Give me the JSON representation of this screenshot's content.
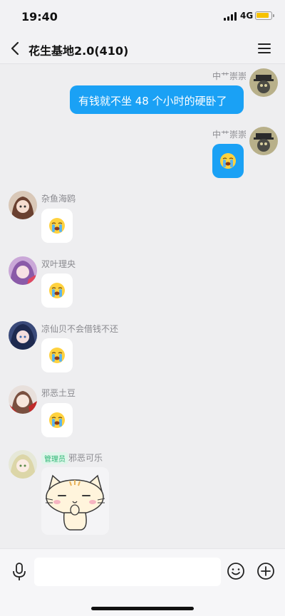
{
  "status_bar": {
    "time": "19:40",
    "network": "4G",
    "battery_level": 0.8,
    "battery_color": "#f6c200"
  },
  "nav": {
    "title": "花生基地2.0(410)",
    "back_icon": "chevron-left-icon",
    "menu_icon": "hamburger-menu-icon"
  },
  "colors": {
    "accent_blue": "#1aa1f5",
    "admin_green": "#2bb673",
    "background": "#eeeef0"
  },
  "messages": [
    {
      "sender": "中艹崇崇",
      "side": "right",
      "type": "text",
      "text": "有钱就不坐 48 个小时的硬卧了"
    },
    {
      "sender": "中艹崇崇",
      "side": "right",
      "type": "emoji",
      "emoji": "loudly-crying-face"
    },
    {
      "sender": "杂鱼海鸥",
      "side": "left",
      "type": "emoji",
      "emoji": "loudly-crying-face"
    },
    {
      "sender": "双叶理央",
      "side": "left",
      "type": "emoji",
      "emoji": "loudly-crying-face"
    },
    {
      "sender": "凉仙贝不会借钱不还",
      "side": "left",
      "type": "emoji",
      "emoji": "loudly-crying-face"
    },
    {
      "sender": "邪恶土豆",
      "side": "left",
      "type": "emoji",
      "emoji": "loudly-crying-face"
    },
    {
      "sender": "邪恶可乐",
      "role_badge": "管理员",
      "side": "left",
      "type": "sticker",
      "sticker": "cat-sticker"
    }
  ],
  "input_bar": {
    "placeholder": "",
    "voice_icon": "microphone-icon",
    "emoji_icon": "smiley-icon",
    "more_icon": "plus-icon"
  }
}
